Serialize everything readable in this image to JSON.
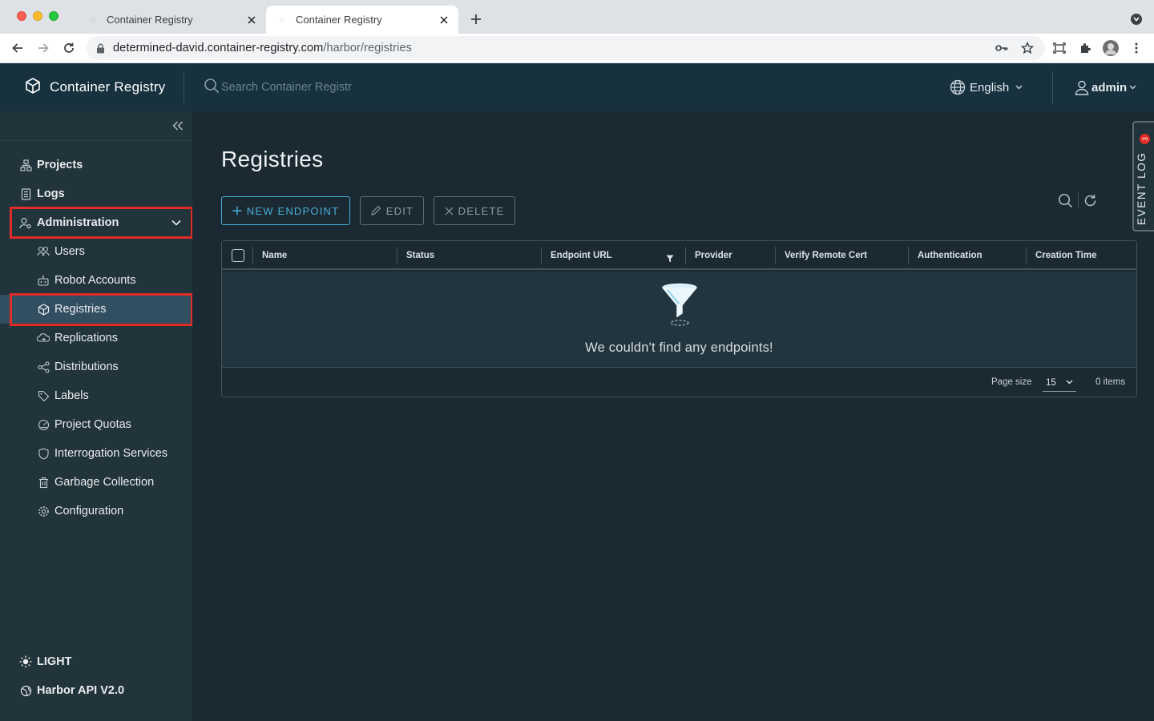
{
  "browser": {
    "tabs": [
      {
        "title": "Container Registry",
        "active": false
      },
      {
        "title": "Container Registry",
        "active": true
      }
    ],
    "url_host": "determined-david.container-registry.com",
    "url_path": "/harbor/registries"
  },
  "header": {
    "brand": "Container Registry",
    "search_placeholder": "Search Container Registr",
    "language": "English",
    "user": "admin"
  },
  "sidebar": {
    "items": [
      {
        "label": "Projects",
        "icon": "projects-icon"
      },
      {
        "label": "Logs",
        "icon": "logs-icon"
      },
      {
        "label": "Administration",
        "icon": "administration-icon"
      }
    ],
    "admin_items": [
      {
        "label": "Users",
        "icon": "users-icon"
      },
      {
        "label": "Robot Accounts",
        "icon": "robot-icon"
      },
      {
        "label": "Registries",
        "icon": "registries-icon",
        "active": true
      },
      {
        "label": "Replications",
        "icon": "replications-icon"
      },
      {
        "label": "Distributions",
        "icon": "distributions-icon"
      },
      {
        "label": "Labels",
        "icon": "labels-icon"
      },
      {
        "label": "Project Quotas",
        "icon": "quotas-icon"
      },
      {
        "label": "Interrogation Services",
        "icon": "shield-icon"
      },
      {
        "label": "Garbage Collection",
        "icon": "trash-icon"
      },
      {
        "label": "Configuration",
        "icon": "gear-icon"
      }
    ],
    "footer": {
      "theme": "LIGHT",
      "api": "Harbor API V2.0"
    }
  },
  "main": {
    "title": "Registries",
    "buttons": {
      "new_endpoint": "NEW ENDPOINT",
      "edit": "EDIT",
      "delete": "DELETE"
    },
    "columns": [
      "Name",
      "Status",
      "Endpoint URL",
      "Provider",
      "Verify Remote Cert",
      "Authentication",
      "Creation Time"
    ],
    "empty_message": "We couldn't find any endpoints!",
    "footer": {
      "page_size_label": "Page size",
      "page_size": "15",
      "items": "0 items"
    }
  },
  "event_log": {
    "label": "EVENT LOG",
    "count": "3"
  },
  "colors": {
    "header_bg": "#17313f",
    "sidebar_bg": "#21333b",
    "main_bg": "#1b2a32",
    "accent": "#4aaed9",
    "highlight": "#e02b27"
  }
}
